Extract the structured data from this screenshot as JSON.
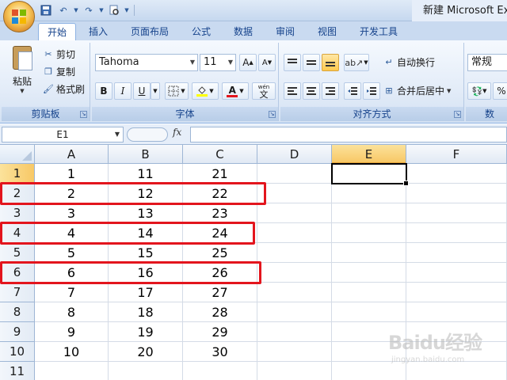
{
  "window": {
    "title": "新建 Microsoft Exc"
  },
  "ribbon_tabs": [
    "开始",
    "插入",
    "页面布局",
    "公式",
    "数据",
    "审阅",
    "视图",
    "开发工具"
  ],
  "clipboard": {
    "paste": "粘贴",
    "cut": "剪切",
    "copy": "复制",
    "format_painter": "格式刷",
    "group_label": "剪贴板"
  },
  "font": {
    "name": "Tahoma",
    "size": "11",
    "bold": "B",
    "italic": "I",
    "underline": "U",
    "font_color_glyph": "A",
    "phonetic": "wén",
    "phonetic_char": "文",
    "group_label": "字体"
  },
  "alignment": {
    "wrap_text": "自动换行",
    "merge_center": "合并后居中",
    "group_label": "对齐方式"
  },
  "number": {
    "format": "常规",
    "percent": "%",
    "group_label_partial": "数"
  },
  "formula_bar": {
    "name_box": "E1",
    "fx": "fx",
    "value": ""
  },
  "sheet": {
    "columns": [
      "A",
      "B",
      "C",
      "D",
      "E",
      "F"
    ],
    "rows": [
      "1",
      "2",
      "3",
      "4",
      "5",
      "6",
      "7",
      "8",
      "9",
      "10",
      "11"
    ],
    "data": [
      [
        "1",
        "11",
        "21"
      ],
      [
        "2",
        "12",
        "22"
      ],
      [
        "3",
        "13",
        "23"
      ],
      [
        "4",
        "14",
        "24"
      ],
      [
        "5",
        "15",
        "25"
      ],
      [
        "6",
        "16",
        "26"
      ],
      [
        "7",
        "17",
        "27"
      ],
      [
        "8",
        "18",
        "28"
      ],
      [
        "9",
        "19",
        "29"
      ],
      [
        "10",
        "20",
        "30"
      ]
    ],
    "selected_cell": "E1",
    "highlighted_rows": [
      "2",
      "4",
      "6"
    ]
  },
  "watermark": {
    "brand": "Baidu经验",
    "url": "jingyan.baidu.com"
  },
  "colors": {
    "highlight_box": "#e3151d",
    "selected_header": "#f8c866",
    "ribbon_blue": "#15428b"
  }
}
